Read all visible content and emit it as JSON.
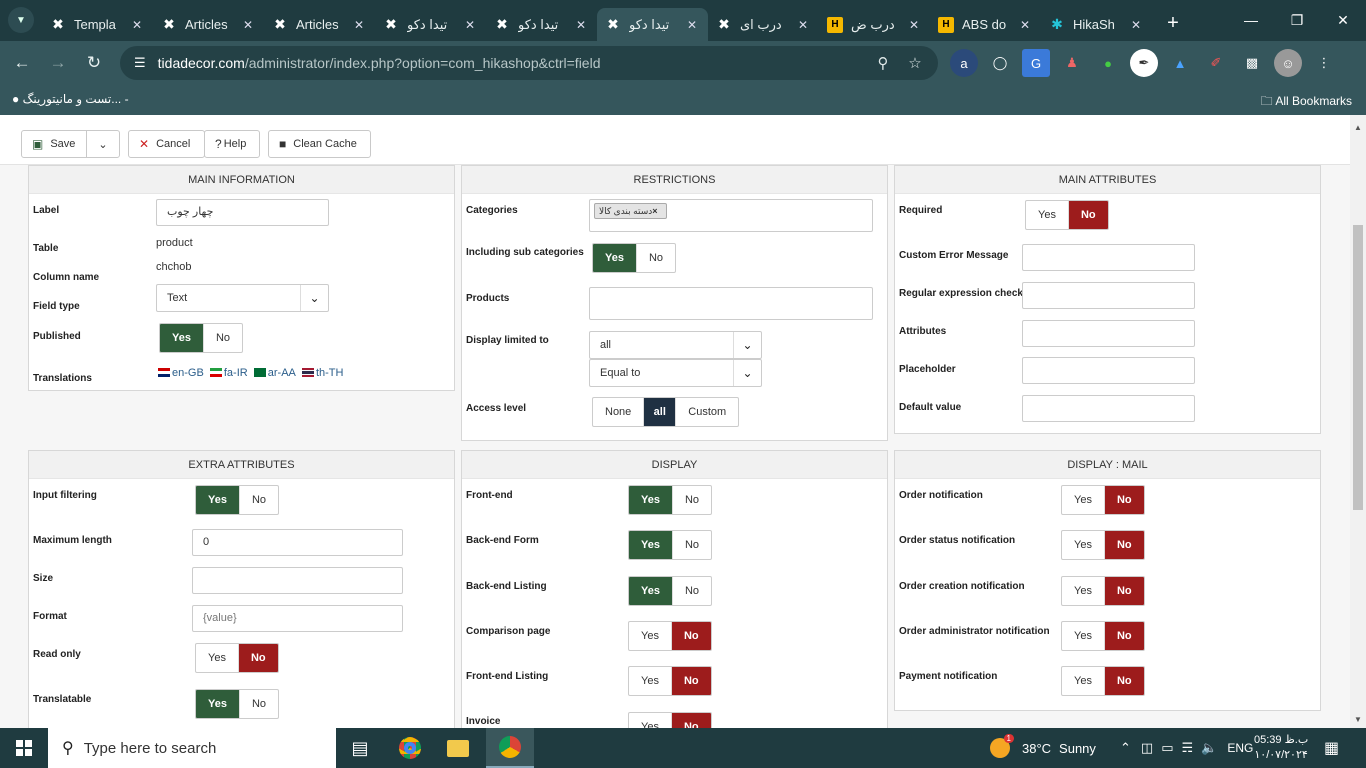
{
  "browser": {
    "tabs": [
      {
        "title": "Templa",
        "icon": "joomla-icon"
      },
      {
        "title": "Articles",
        "icon": "joomla-icon"
      },
      {
        "title": "Articles",
        "icon": "joomla-icon"
      },
      {
        "title": "تیدا دکو",
        "icon": "joomla-icon"
      },
      {
        "title": "تیدا دکو",
        "icon": "joomla-icon"
      },
      {
        "title": "تیدا دکو",
        "icon": "joomla-icon"
      },
      {
        "title": "درب ای",
        "icon": "joomla-icon"
      },
      {
        "title": "درب ض",
        "icon": "hikashop-icon"
      },
      {
        "title": "ABS do",
        "icon": "hikashop-icon"
      },
      {
        "title": "HikaSh",
        "icon": "hikashop-icon"
      }
    ],
    "url_host": "tidadecor.com",
    "url_path": "/administrator/index.php?option=com_hikashop&ctrl=field",
    "bookmark_left": "تست و مانیتورینگ... -",
    "bookmark_right": "All Bookmarks"
  },
  "toolbar": {
    "save": "Save",
    "cancel": "Cancel",
    "help": "Help",
    "clean_cache": "Clean Cache"
  },
  "main_information": {
    "title": "MAIN INFORMATION",
    "label_label": "Label",
    "label_value": "چهار چوب",
    "table_label": "Table",
    "table_value": "product",
    "column_label": "Column name",
    "column_value": "chchob",
    "fieldtype_label": "Field type",
    "fieldtype_value": "Text",
    "published_label": "Published",
    "translations_label": "Translations",
    "langs": [
      "en-GB",
      "fa-IR",
      "ar-AA",
      "th-TH"
    ]
  },
  "restrictions": {
    "title": "RESTRICTIONS",
    "categories_label": "Categories",
    "category_tag": "دسته بندی کالا",
    "subcat_label": "Including sub categories",
    "products_label": "Products",
    "display_limited_label": "Display limited to",
    "display_limited_value": "all",
    "display_limited_op": "Equal to",
    "access_label": "Access level",
    "access_none": "None",
    "access_all": "all",
    "access_custom": "Custom"
  },
  "main_attributes": {
    "title": "MAIN ATTRIBUTES",
    "required": "Required",
    "custom_error": "Custom Error Message",
    "regex": "Regular expression check",
    "attributes": "Attributes",
    "placeholder": "Placeholder",
    "default_value": "Default value"
  },
  "extra_attributes": {
    "title": "EXTRA ATTRIBUTES",
    "input_filtering": "Input filtering",
    "max_length": "Maximum length",
    "max_length_value": "0",
    "size": "Size",
    "format": "Format",
    "format_placeholder": "{value}",
    "read_only": "Read only",
    "translatable": "Translatable"
  },
  "display": {
    "title": "DISPLAY",
    "frontend": "Front-end",
    "backend_form": "Back-end Form",
    "backend_listing": "Back-end Listing",
    "comparison": "Comparison page",
    "frontend_listing": "Front-end Listing",
    "invoice": "Invoice"
  },
  "display_mail": {
    "title": "DISPLAY : MAIL",
    "order_notification": "Order notification",
    "order_status": "Order status notification",
    "order_creation": "Order creation notification",
    "order_admin": "Order administrator notification",
    "payment": "Payment notification"
  },
  "common": {
    "yes": "Yes",
    "no": "No"
  },
  "taskbar": {
    "search_placeholder": "Type here to search",
    "temp": "38°C",
    "weather": "Sunny",
    "badge": "1",
    "lang": "ENG",
    "time": "05:39 ب.ظ",
    "date": "۱۰/۰۷/۲۰۲۴"
  },
  "colors": {
    "yes_green": "#2f5d3a",
    "no_red": "#9d1c1c",
    "access_navy": "#1f3042",
    "chrome_dark": "#1f3b40",
    "chrome_light": "#35565c"
  }
}
